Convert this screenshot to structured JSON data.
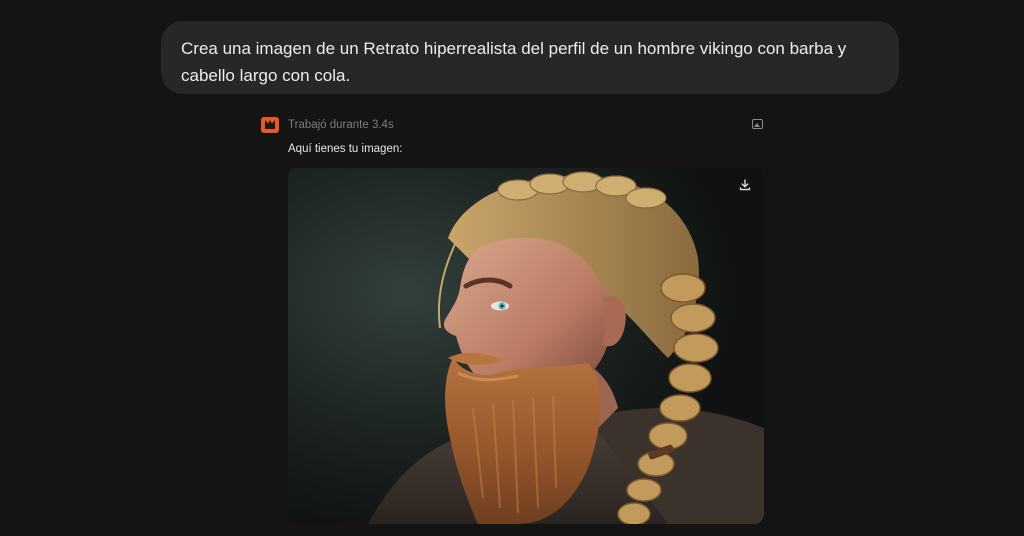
{
  "conversation": {
    "user_message": "Crea una imagen de un Retrato hiperrealista del perfil de un hombre vikingo con barba y cabello largo con cola.",
    "assistant": {
      "status": "Trabajó durante 3.4s",
      "reply": "Aquí tienes tu imagen:",
      "logo_icon": "cat-logo-icon",
      "image_icon": "image-icon",
      "download_icon": "download-icon"
    }
  },
  "colors": {
    "background": "#141414",
    "bubble": "#272727",
    "logo_accent": "#e8592a",
    "text_primary": "#ececec",
    "text_muted": "#7d7d7d"
  }
}
